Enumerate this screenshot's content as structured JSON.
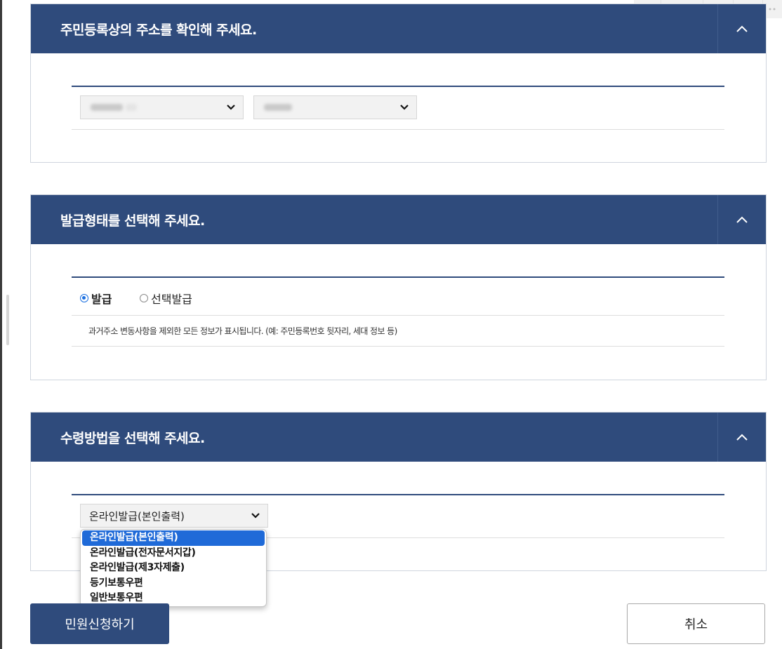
{
  "toolbar": {
    "icons": [
      "comment-icon",
      "bookmark-icon",
      "chevron-down-icon",
      "list-icon",
      "download-icon",
      "more-icon"
    ]
  },
  "section_address": {
    "title": "주민등록상의 주소를 확인해 주세요.",
    "toggle_icon": "chevron-up-icon"
  },
  "section_issue_type": {
    "title": "발급형태를 선택해 주세요.",
    "toggle_icon": "chevron-up-icon",
    "options": [
      "발급",
      "선택발급"
    ],
    "selected": "발급",
    "note": "과거주소 변동사항을 제외한 모든 정보가 표시됩니다. (예: 주민등록번호 뒷자리, 세대 정보 등)"
  },
  "section_receive": {
    "title": "수령방법을 선택해 주세요.",
    "toggle_icon": "chevron-up-icon",
    "selected_value": "온라인발급(본인출력)",
    "options": [
      "온라인발급(본인출력)",
      "온라인발급(전자문서지갑)",
      "온라인발급(제3자제출)",
      "등기보통우편",
      "일반보통우편"
    ]
  },
  "actions": {
    "submit_label": "민원신청하기",
    "cancel_label": "취소"
  },
  "colors": {
    "header_bg": "#2f4b7c",
    "selected_option": "#1f6ad8",
    "radio_accent": "#1a6fe0"
  }
}
